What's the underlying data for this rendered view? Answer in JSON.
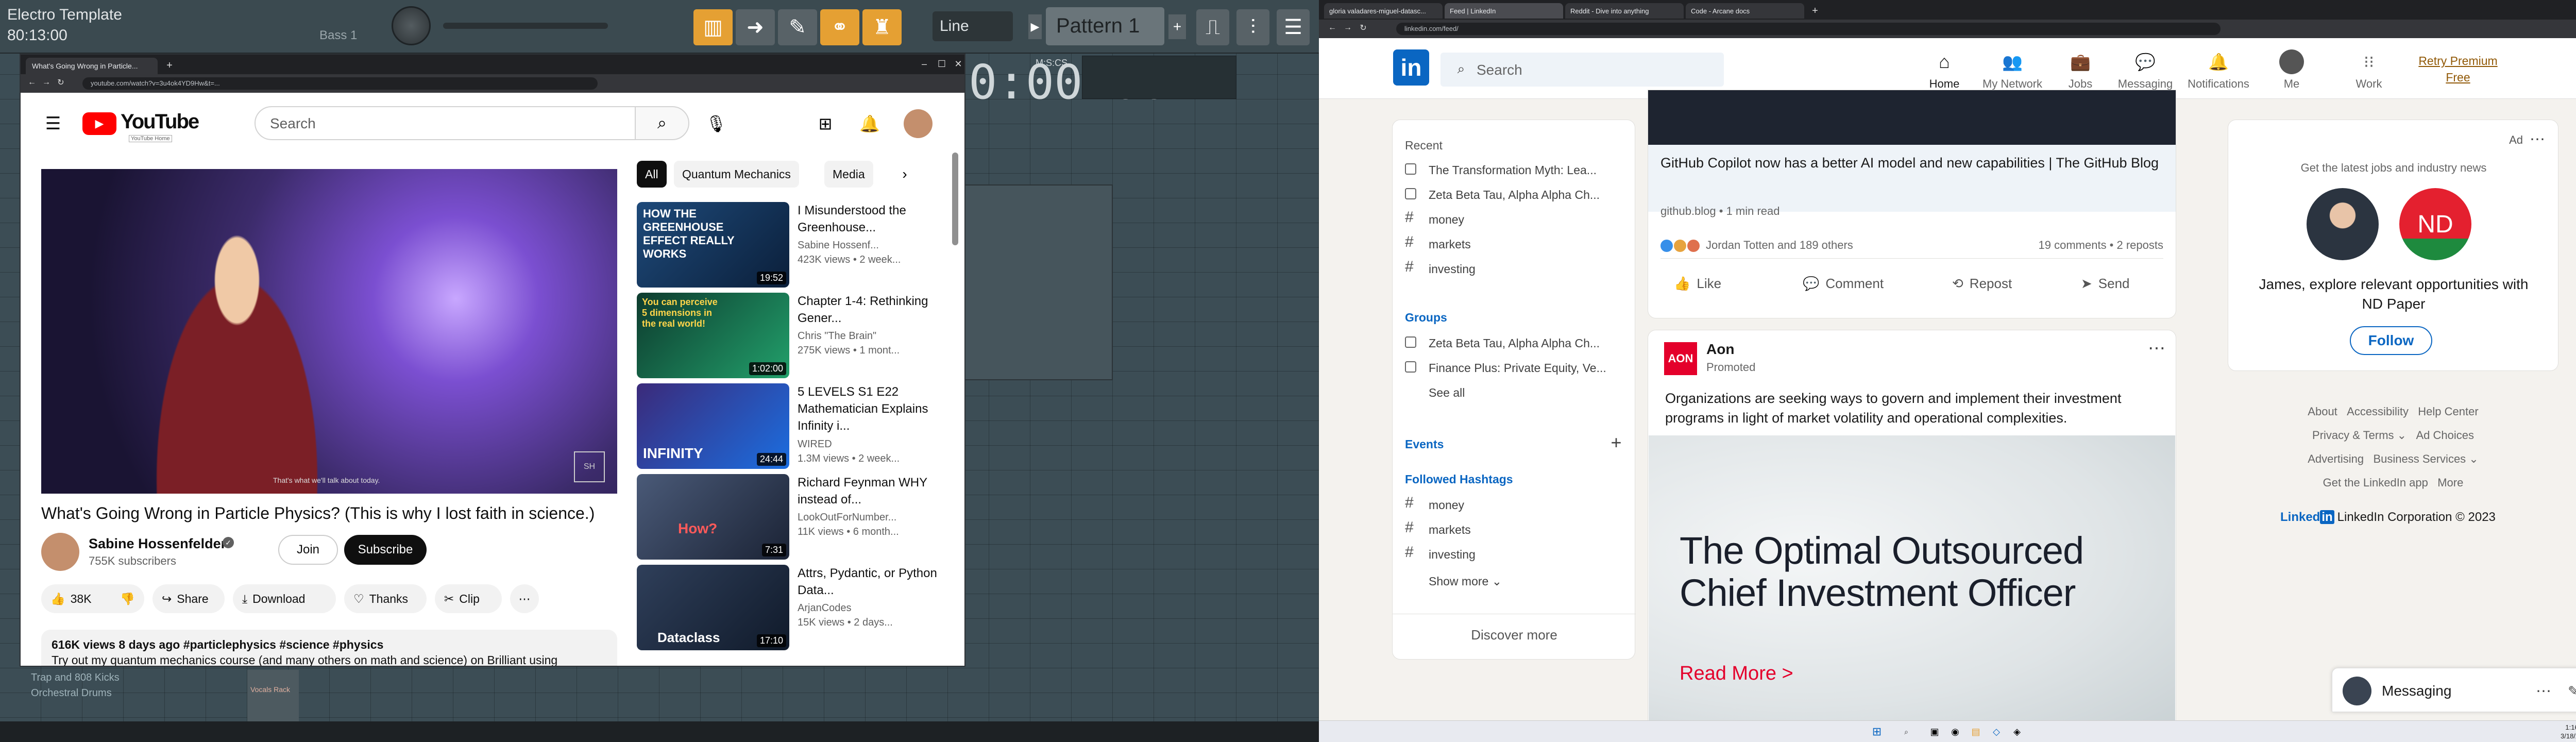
{
  "fl": {
    "title": "Electro Template",
    "time": "80:13:00",
    "bass": "Bass 1",
    "line_mode": "Line",
    "pattern": "Pattern 1",
    "big_time": "0:00:00",
    "mscs": "M:S:CS",
    "channels": [
      "Trap and 808 Kicks",
      "Orchestral Drums"
    ],
    "ch_header": "Vocals Rack"
  },
  "yt": {
    "tab": "What's Going Wrong in Particle...",
    "url": "youtube.com/watch?v=3u4ok4YD9Hw&t=...",
    "logo": "YouTube",
    "logo_sub": "YouTube Home",
    "search_placeholder": "Search",
    "subtitle": "That's what we'll talk about today.",
    "title": "What's Going Wrong in Particle Physics? (This is why I lost faith in science.)",
    "channel": "Sabine Hossenfelder",
    "subs": "755K subscribers",
    "join": "Join",
    "subscribe": "Subscribe",
    "likes": "38K",
    "share": "Share",
    "download": "Download",
    "thanks": "Thanks",
    "clip": "Clip",
    "desc_meta": "616K views  8 days ago  #particlephysics #science #physics",
    "desc_text": "Try out my quantum mechanics course (and many others on math and science) on Brilliant using",
    "chips": [
      "All",
      "Quantum Mechanics",
      "Media"
    ],
    "recs": [
      {
        "title": "I Misunderstood the Greenhouse...",
        "channel": "Sabine Hossenf...",
        "meta": "423K views • 2 week...",
        "dur": "19:52",
        "thumb": "HOW THE GREENHOUSE EFFECT REALLY WORKS"
      },
      {
        "title": "Chapter 1-4: Rethinking Gener...",
        "channel": "Chris \"The Brain\"",
        "meta": "275K views • 1 mont...",
        "dur": "1:02:00",
        "thumb": "You can perceive 5 dimensions in the real world!"
      },
      {
        "title": "5 LEVELS  S1 E22 Mathematician Explains Infinity i...",
        "channel": "WIRED",
        "meta": "1.3M views • 2 week...",
        "dur": "24:44",
        "thumb": "INFINITY"
      },
      {
        "title": "Richard Feynman WHY instead of...",
        "channel": "LookOutForNumber...",
        "meta": "11K views • 6 month...",
        "dur": "7:31",
        "thumb": "How?"
      },
      {
        "title": "Attrs, Pydantic, or Python Data...",
        "channel": "ArjanCodes",
        "meta": "15K views • 2 days...",
        "dur": "17:10",
        "thumb": "Dataclass"
      }
    ]
  },
  "li": {
    "tabs": [
      "gloria valadares-miguel-datasc...",
      "Feed | LinkedIn",
      "Reddit - Dive into anything",
      "Code - Arcane docs"
    ],
    "url": "linkedin.com/feed/",
    "search": "Search",
    "nav": [
      "Home",
      "My Network",
      "Jobs",
      "Messaging",
      "Notifications",
      "Me",
      "Work"
    ],
    "premium": "Retry Premium Free",
    "recent_h": "Recent",
    "recent": [
      "The Transformation Myth: Lea...",
      "Zeta Beta Tau, Alpha Alpha Ch...",
      "money",
      "markets",
      "investing"
    ],
    "groups_h": "Groups",
    "groups": [
      "Zeta Beta Tau, Alpha Alpha Ch...",
      "Finance Plus: Private Equity, Ve..."
    ],
    "see_all": "See all",
    "events_h": "Events",
    "hashtags_h": "Followed Hashtags",
    "hashtags": [
      "money",
      "markets",
      "investing"
    ],
    "show_more": "Show more",
    "discover": "Discover more",
    "post_title": "GitHub Copilot now has a better AI model and new capabilities | The GitHub Blog",
    "post_src": "github.blog • 1 min read",
    "reactions": "Jordan Totten and 189 others",
    "comments": "19 comments • 2 reposts",
    "actions": [
      "Like",
      "Comment",
      "Repost",
      "Send"
    ],
    "ad_name": "Aon",
    "ad_prom": "Promoted",
    "ad_text": "Organizations are seeking ways to govern and implement their investment programs in light of market volatility and operational complexities.",
    "ad_head": "The Optimal Outsourced Chief Investment Officer",
    "ad_cta": "Read More >",
    "side_ad": "Ad",
    "side_sub": "Get the latest jobs and industry news",
    "side_text": "James, explore relevant opportunities with",
    "side_co": "ND Paper",
    "follow": "Follow",
    "nd": "ND",
    "footer": [
      "About",
      "Accessibility",
      "Help Center",
      "Privacy & Terms",
      "Ad Choices",
      "Advertising",
      "Business Services",
      "Get the LinkedIn app",
      "More"
    ],
    "corp": "LinkedIn Corporation © 2023",
    "li_word": "Linked",
    "messaging": "Messaging",
    "clock": "1:16 PM",
    "date": "3/18/2023"
  },
  "colors": {
    "linkedin_blue": "#0a66c2",
    "youtube_red": "#ff0000",
    "fl_orange": "#e5a033",
    "aon_red": "#e4002b"
  }
}
